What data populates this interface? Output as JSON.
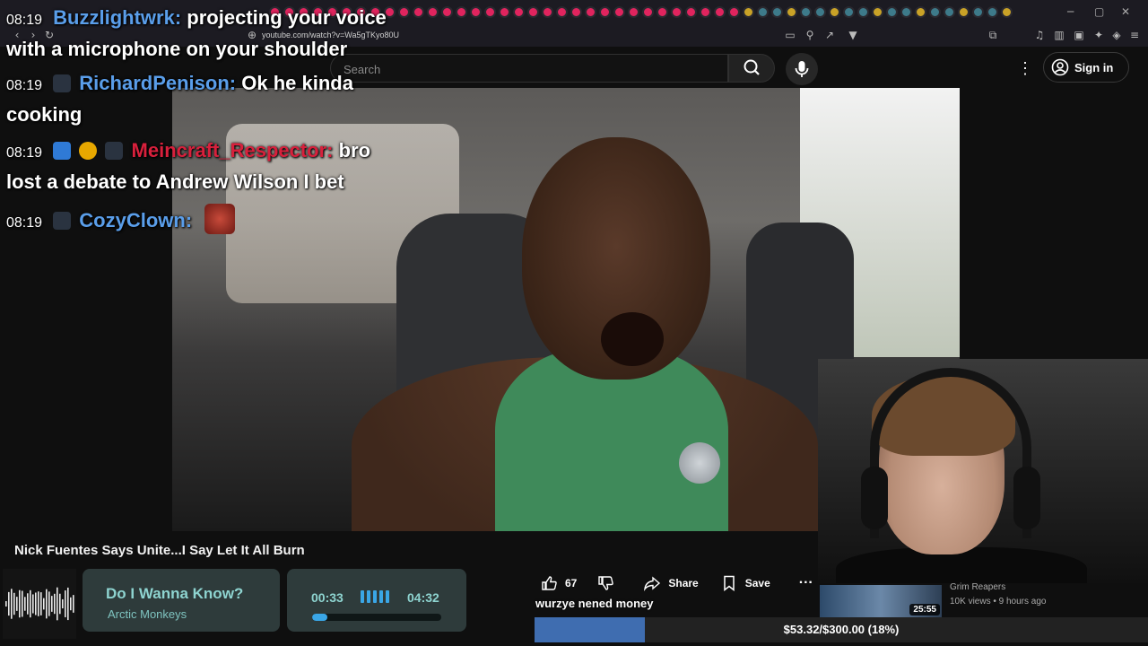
{
  "browser": {
    "url": "youtube.com/watch?v=Wa5gTKyo80U",
    "window_controls": {
      "minimize": "─",
      "maximize": "▢",
      "close": "✕"
    }
  },
  "header": {
    "search_placeholder": "Search",
    "signin_label": "Sign in",
    "more_icon": "⋮"
  },
  "chat": {
    "messages": [
      {
        "time": "08:19",
        "user": "Buzzlightwrk:",
        "text": "projecting your voice with a microphone on your shoulder"
      },
      {
        "time": "08:19",
        "user": "RichardPenison:",
        "text": "Ok he kinda cooking"
      },
      {
        "time": "08:19",
        "user": "Meincraft_Respector:",
        "text": "bro lost a debate to Andrew Wilson I bet"
      },
      {
        "time": "08:19",
        "user": "CozyClown:",
        "text": ""
      }
    ]
  },
  "video": {
    "title": "Nick Fuentes Says Unite...I Say Let It All Burn"
  },
  "actions": {
    "like_count": "67",
    "share_label": "Share",
    "save_label": "Save",
    "more_label": "···"
  },
  "recommended": {
    "duration": "25:55",
    "channel": "Grim Reapers",
    "meta": "10K views • 9 hours ago"
  },
  "music": {
    "song": "Do I Wanna Know?",
    "artist": "Arctic Monkeys",
    "current_time": "00:33",
    "total_time": "04:32",
    "progress_fraction": 0.12
  },
  "goal": {
    "label": "wurzye nened money",
    "text": "$53.32/$300.00 (18%)",
    "fraction": 0.18
  },
  "colors": {
    "user_blue": "#5a9eea",
    "user_red": "#d8203c",
    "music_accent": "#8ed4d0",
    "goal_fill": "#3f6db0"
  }
}
